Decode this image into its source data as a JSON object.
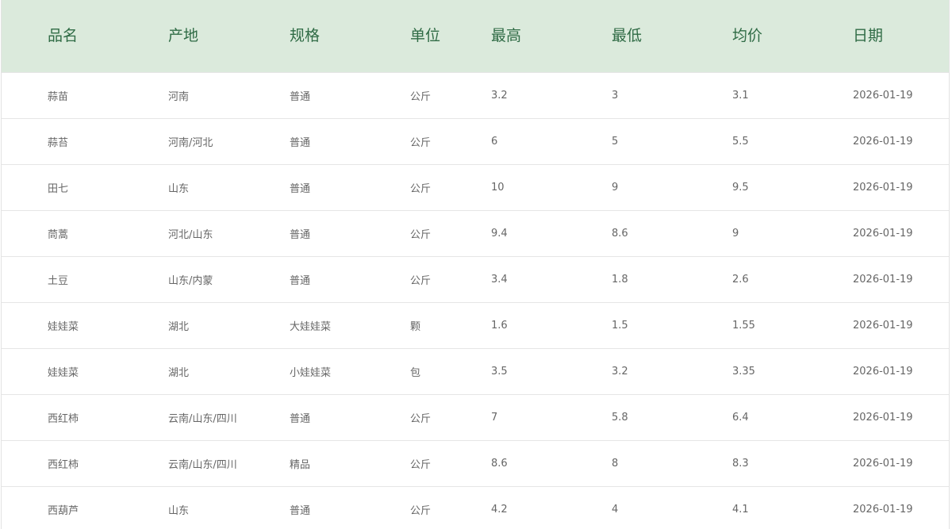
{
  "table": {
    "headers": [
      "品名",
      "产地",
      "规格",
      "单位",
      "最高",
      "最低",
      "均价",
      "日期"
    ],
    "rows": [
      [
        "蒜苗",
        "河南",
        "普通",
        "公斤",
        "3.2",
        "3",
        "3.1",
        "2026-01-19"
      ],
      [
        "蒜苔",
        "河南/河北",
        "普通",
        "公斤",
        "6",
        "5",
        "5.5",
        "2026-01-19"
      ],
      [
        "田七",
        "山东",
        "普通",
        "公斤",
        "10",
        "9",
        "9.5",
        "2026-01-19"
      ],
      [
        "茼蒿",
        "河北/山东",
        "普通",
        "公斤",
        "9.4",
        "8.6",
        "9",
        "2026-01-19"
      ],
      [
        "土豆",
        "山东/内蒙",
        "普通",
        "公斤",
        "3.4",
        "1.8",
        "2.6",
        "2026-01-19"
      ],
      [
        "娃娃菜",
        "湖北",
        "大娃娃菜",
        "颗",
        "1.6",
        "1.5",
        "1.55",
        "2026-01-19"
      ],
      [
        "娃娃菜",
        "湖北",
        "小娃娃菜",
        "包",
        "3.5",
        "3.2",
        "3.35",
        "2026-01-19"
      ],
      [
        "西红柿",
        "云南/山东/四川",
        "普通",
        "公斤",
        "7",
        "5.8",
        "6.4",
        "2026-01-19"
      ],
      [
        "西红柿",
        "云南/山东/四川",
        "精品",
        "公斤",
        "8.6",
        "8",
        "8.3",
        "2026-01-19"
      ],
      [
        "西葫芦",
        "山东",
        "普通",
        "公斤",
        "4.2",
        "4",
        "4.1",
        "2026-01-19"
      ]
    ]
  },
  "colors": {
    "header_bg": "#dbeadc",
    "header_text": "#2f6b45",
    "cell_text": "#666666",
    "row_border": "#e6e6e6"
  }
}
